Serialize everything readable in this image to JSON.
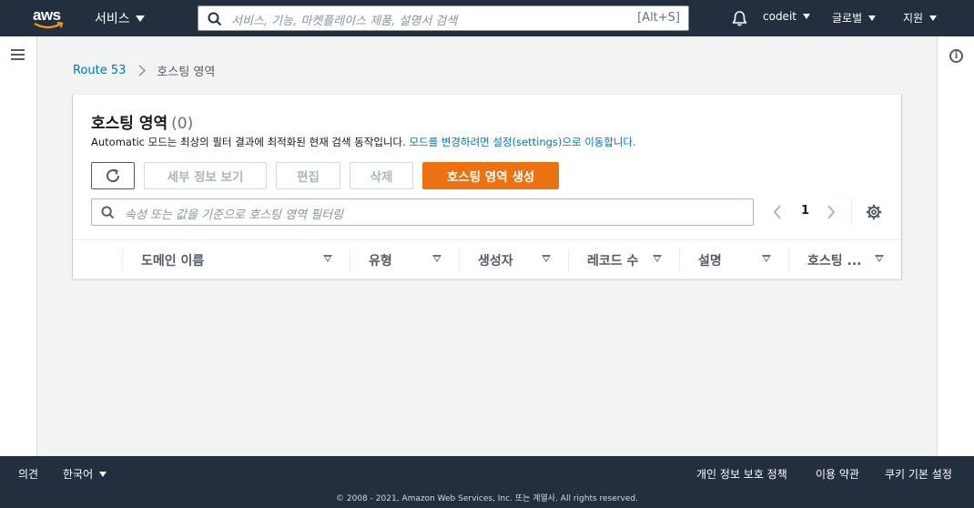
{
  "nav": {
    "logo_text": "aws",
    "services_label": "서비스",
    "search_placeholder": "서비스, 기능, 마켓플레이스 제품, 설명서 검색",
    "search_shortcut": "[Alt+S]",
    "account": "codeit",
    "region": "글로벌",
    "support": "지원"
  },
  "breadcrumb": {
    "root": "Route 53",
    "current": "호스팅 영역"
  },
  "panel": {
    "title": "호스팅 영역",
    "count": "(0)",
    "description_prefix": "Automatic 모드는 최상의 필터 결과에 최적화된 현재 검색 동작입니다. ",
    "description_link": "모드를 변경하려면 설정(settings)으로 이동합니다.",
    "buttons": {
      "view_details": "세부 정보 보기",
      "edit": "편집",
      "delete": "삭제",
      "create": "호스팅 영역 생성"
    },
    "filter_placeholder": "속성 또는 값을 기준으로 호스팅 영역 필터링",
    "page_number": "1",
    "columns": [
      "도메인 이름",
      "유형",
      "생성자",
      "레코드 수",
      "설명",
      "호스팅 ..."
    ]
  },
  "footer": {
    "feedback": "의견",
    "language": "한국어",
    "privacy": "개인 정보 보호 정책",
    "terms": "이용 약관",
    "cookies": "쿠키 기본 설정",
    "copyright": "© 2008 - 2021, Amazon Web Services, Inc. 또는 계열사. All rights reserved."
  },
  "colors": {
    "nav_bg": "#232f3e",
    "primary_button": "#ec7211",
    "link": "#0073bb"
  }
}
